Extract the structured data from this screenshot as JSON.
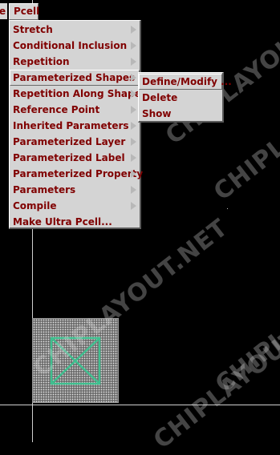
{
  "menubar": {
    "prev_label": "e",
    "pcell_label": "Pcell"
  },
  "pcell_menu": {
    "items": [
      {
        "label": "Stretch",
        "submenu": true
      },
      {
        "label": "Conditional Inclusion",
        "submenu": true
      },
      {
        "label": "Repetition",
        "submenu": true
      },
      {
        "label": "Parameterized Shapes",
        "submenu": true,
        "active": true
      },
      {
        "label": "Repetition Along Shape",
        "submenu": true
      },
      {
        "label": "Reference Point",
        "submenu": true
      },
      {
        "label": "Inherited Parameters",
        "submenu": true
      },
      {
        "label": "Parameterized Layer",
        "submenu": true
      },
      {
        "label": "Parameterized Label",
        "submenu": true
      },
      {
        "label": "Parameterized Property",
        "submenu": true
      },
      {
        "label": "Parameters",
        "submenu": true
      },
      {
        "label": "Compile",
        "submenu": true
      },
      {
        "label": "Make Ultra Pcell...",
        "submenu": false
      }
    ]
  },
  "shapes_submenu": {
    "items": [
      {
        "label": "Define/Modify ..."
      },
      {
        "label": "Delete"
      },
      {
        "label": "Show"
      }
    ]
  },
  "watermarks": [
    "CHIPLAYOUT.NET",
    "CHIPLAYOUT.NET",
    "CHIPLA",
    "CHIPLA",
    "CHIPLAYOUT.NET"
  ],
  "colors": {
    "menu_text": "#800000",
    "menu_bg": "#d4d4d4",
    "contact_outline": "#3fbf8f",
    "canvas_bg": "#000000"
  }
}
